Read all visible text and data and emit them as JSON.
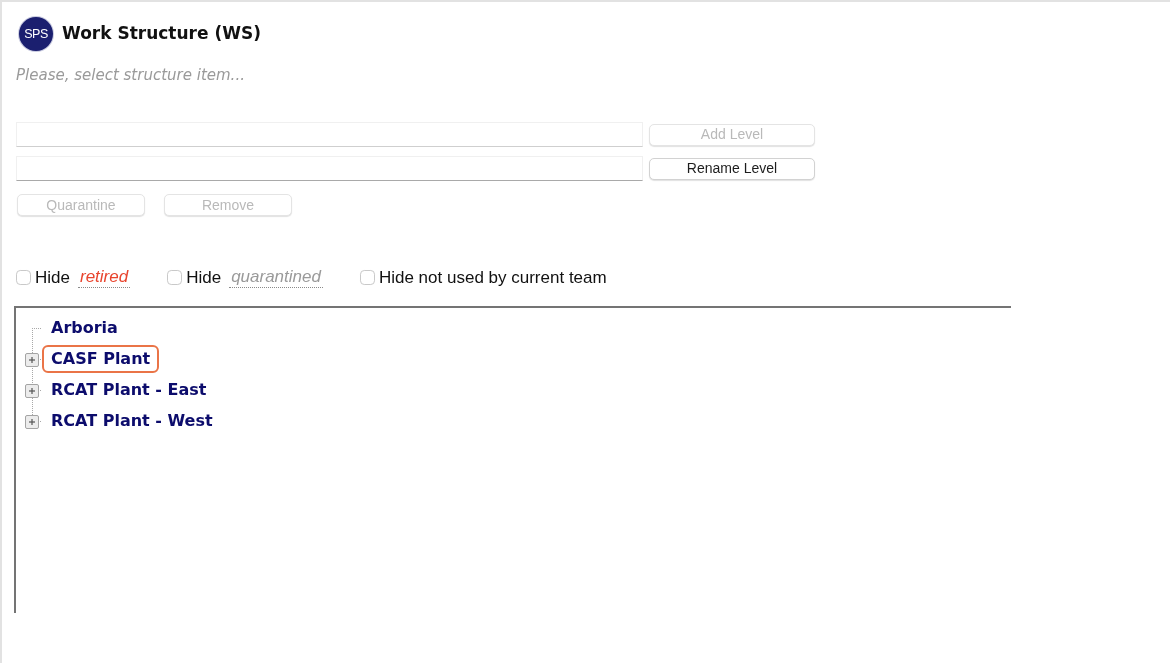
{
  "header": {
    "logo": "SPS",
    "title": "Work Structure (WS)",
    "subtitle": "Please, select structure item..."
  },
  "level_editor": [
    {
      "button": "Add Level",
      "disabled": true
    },
    {
      "button": "Rename Level",
      "disabled": false
    }
  ],
  "actions": [
    {
      "label": "Quarantine",
      "disabled": true
    },
    {
      "label": "Remove",
      "disabled": true
    }
  ],
  "filters": [
    {
      "label": "Hide",
      "term": {
        "text": "retired",
        "color": "#e8442d"
      },
      "checked": false
    },
    {
      "label": "Hide",
      "term": {
        "text": "quarantined",
        "color": "#9a9a9a"
      },
      "checked": false
    },
    {
      "label": "Hide not used by current team",
      "checked": false
    }
  ],
  "tree": {
    "items": [
      {
        "label": "Arboria",
        "kind": "leaf",
        "selected": false
      },
      {
        "label": "CASF Plant",
        "kind": "branch",
        "expanded": false,
        "selected": true
      },
      {
        "label": "RCAT Plant - East",
        "kind": "branch",
        "expanded": false,
        "selected": false
      },
      {
        "label": "RCAT Plant - West",
        "kind": "branch",
        "expanded": false,
        "selected": false
      }
    ]
  }
}
